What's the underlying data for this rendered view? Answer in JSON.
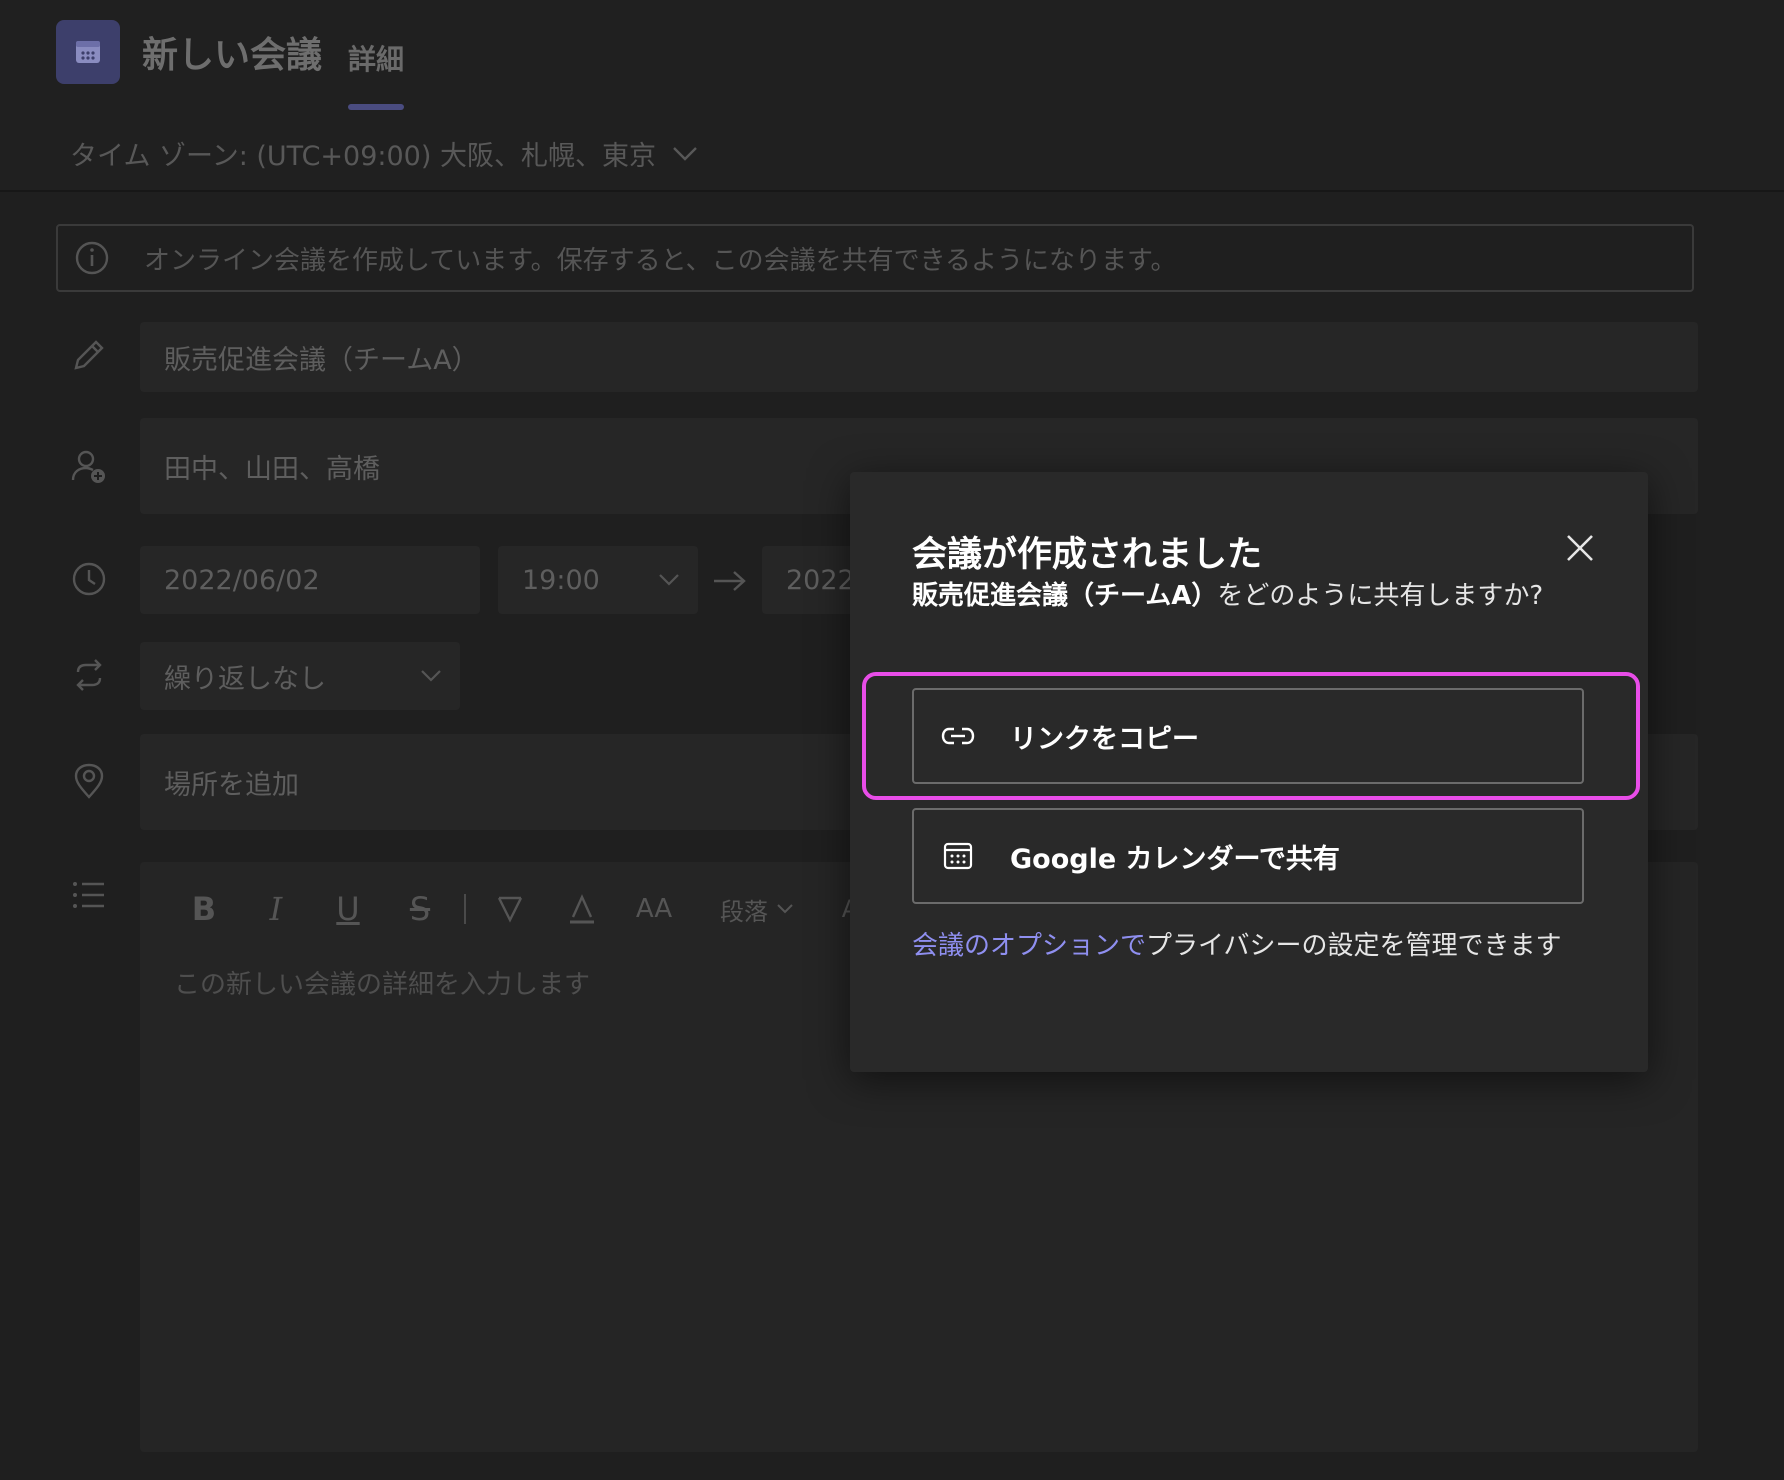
{
  "header": {
    "title": "新しい会議",
    "tab_details": "詳細",
    "timezone": "タイム ゾーン: (UTC+09:00) 大阪、札幌、東京"
  },
  "banner": {
    "text": "オンライン会議を作成しています。保存すると、この会議を共有できるようになります。"
  },
  "form": {
    "title_value": "販売促進会議（チームA）",
    "attendees_value": "田中、山田、高橋",
    "start_date": "2022/06/02",
    "start_time": "19:00",
    "end_date_partial": "2022",
    "recurrence": "繰り返しなし",
    "location_placeholder": "場所を追加",
    "editor_placeholder": "この新しい会議の詳細を入力します",
    "paragraph_label": "段落"
  },
  "dialog": {
    "title": "会議が作成されました",
    "subtitle_bold": "販売促進会議（チームA）",
    "subtitle_rest": "をどのように共有しますか?",
    "copy_link_label": "リンクをコピー",
    "google_share_label": "Google カレンダーで共有",
    "footer_link": "会議のオプションで",
    "footer_rest": "プライバシーの設定を管理できます"
  },
  "colors": {
    "highlight": "#e84de8",
    "link": "#8f8ff0",
    "brand_icon_bg": "#3d3f6b"
  }
}
